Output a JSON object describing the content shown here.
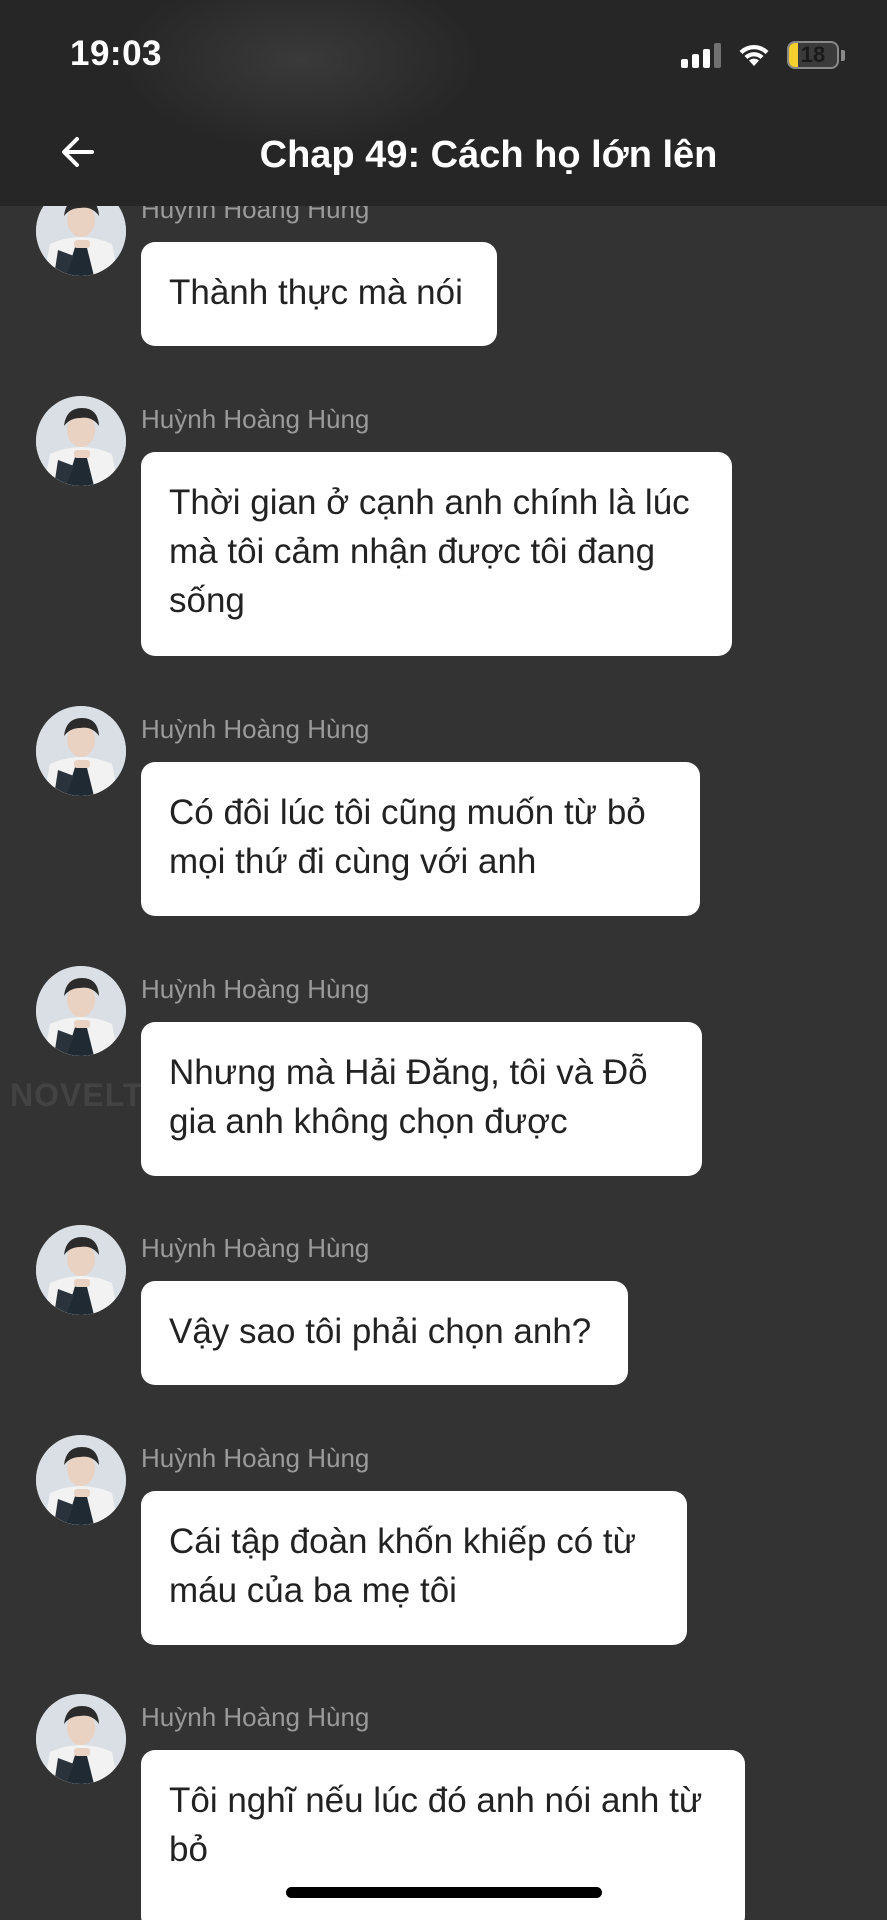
{
  "status_bar": {
    "time": "19:03",
    "battery_level": "18",
    "battery_fraction": 0.18,
    "signal_icon": "cellular-signal-icon",
    "wifi_icon": "wifi-icon"
  },
  "header": {
    "back_icon": "arrow-left-icon",
    "title": "Chap 49: Cách họ lớn lên"
  },
  "watermark": "NOVELTOON",
  "messages": [
    {
      "sender": "Huỳnh Hoàng Hùng",
      "text": "Thành thực mà nói"
    },
    {
      "sender": "Huỳnh Hoàng Hùng",
      "text": "Thời gian ở cạnh anh chính là lúc mà tôi cảm nhận được tôi đang sống"
    },
    {
      "sender": "Huỳnh Hoàng Hùng",
      "text": "Có đôi lúc tôi cũng muốn từ bỏ mọi thứ đi cùng với anh"
    },
    {
      "sender": "Huỳnh Hoàng Hùng",
      "text": "Nhưng mà Hải Đăng, tôi và Đỗ gia anh không chọn được"
    },
    {
      "sender": "Huỳnh Hoàng Hùng",
      "text": "Vậy sao tôi phải chọn anh?"
    },
    {
      "sender": "Huỳnh Hoàng Hùng",
      "text": "Cái tập đoàn khốn khiếp có từ máu của ba mẹ tôi"
    },
    {
      "sender": "Huỳnh Hoàng Hùng",
      "text": "Tôi nghĩ nếu lúc đó anh nói anh từ bỏ"
    }
  ],
  "colors": {
    "background": "#333333",
    "header": "#262626",
    "bubble": "#ffffff",
    "sender_name": "#9a9a9a",
    "battery_fill": "#f4cf2d"
  }
}
